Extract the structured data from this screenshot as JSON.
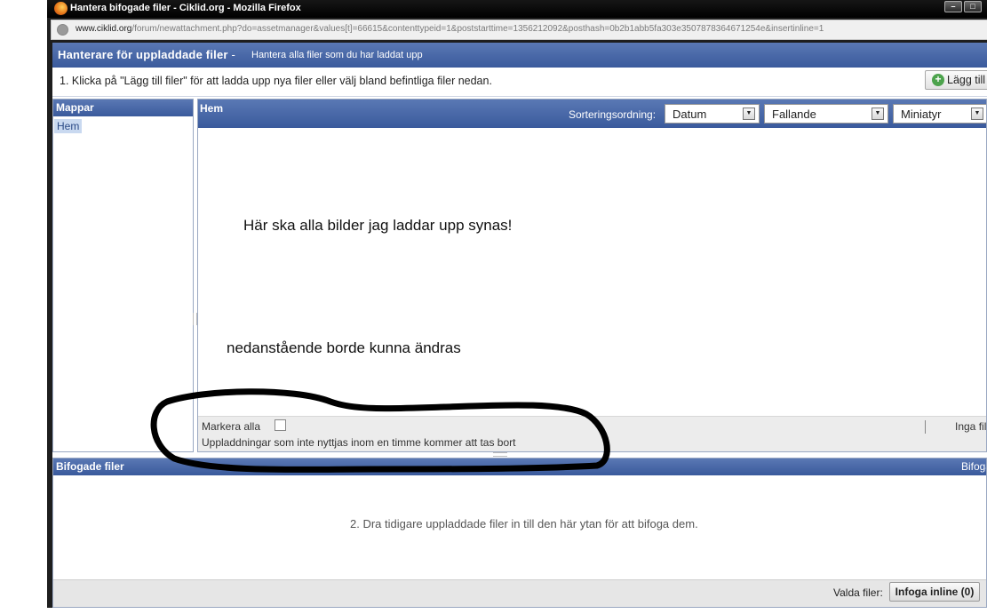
{
  "window": {
    "title": "Hantera bifogade filer - Ciklid.org - Mozilla Firefox",
    "buttons": {
      "minimize": "–",
      "maximize": "□"
    }
  },
  "addressbar": {
    "domain": "www.ciklid.org",
    "path": "/forum/newattachment.php?do=assetmanager&values[t]=66615&contenttypeid=1&poststarttime=1356212092&posthash=0b2b1abb5fa303e3507878364671254e&insertinline=1"
  },
  "header": {
    "title": "Hanterare för uppladdade filer",
    "separator": "-",
    "subtitle": "Hantera alla filer som du har laddat upp"
  },
  "instructions": "1. Klicka på \"Lägg till filer\" för att ladda upp nya filer eller välj bland befintliga filer nedan.",
  "add_button": {
    "icon": "plus-circle-icon",
    "label": "Lägg till filer"
  },
  "folders": {
    "title": "Mappar",
    "items": [
      "Hem"
    ]
  },
  "main": {
    "title": "Hem",
    "sort_label": "Sorteringsordning:",
    "sort_by": "Datum",
    "sort_direction": "Fallande",
    "view_mode": "Miniatyr"
  },
  "annotations": {
    "note_1": "Här ska alla bilder jag laddar upp synas!",
    "note_2": "nedanstående borde kunna ändras"
  },
  "upload_area": {
    "mark_all": "Markera alla",
    "note": "Uppladdningar som inte nyttjas inom en timme kommer att tas bort",
    "no_files": "Inga filer"
  },
  "attached": {
    "title": "Bifogade filer",
    "right_label": "Bifogade filer",
    "drag_note": "2. Dra tidigare uppladdade filer in till den här ytan för att bifoga dem.",
    "selected_label": "Valda filer:",
    "insert_inline_button": "Infoga inline (0)"
  },
  "colors": {
    "header_blue": "#3a5a9c",
    "header_blue_light": "#5a78b4",
    "selected_folder": "#c9d9f0"
  }
}
